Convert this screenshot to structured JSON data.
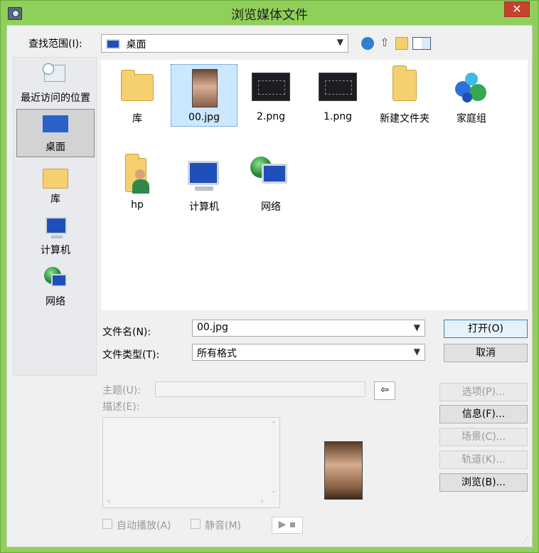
{
  "window": {
    "title": "浏览媒体文件",
    "close_label": "✕"
  },
  "lookin": {
    "label": "查找范围(I):",
    "value": "桌面"
  },
  "places": [
    {
      "label": "最近访问的位置",
      "icon": "recent-places-icon"
    },
    {
      "label": "桌面",
      "icon": "desktop-icon",
      "selected": true
    },
    {
      "label": "库",
      "icon": "library-icon"
    },
    {
      "label": "计算机",
      "icon": "computer-icon"
    },
    {
      "label": "网络",
      "icon": "network-icon"
    }
  ],
  "files": [
    {
      "name": "库",
      "icon": "library-folder-icon"
    },
    {
      "name": "00.jpg",
      "icon": "photo-thumbnail-icon",
      "selected": true
    },
    {
      "name": "2.png",
      "icon": "screenshot-thumbnail-icon"
    },
    {
      "name": "1.png",
      "icon": "screenshot-thumbnail-icon"
    },
    {
      "name": "新建文件夹",
      "icon": "folder-icon"
    },
    {
      "name": "家庭组",
      "icon": "homegroup-icon"
    },
    {
      "name": "hp",
      "icon": "user-folder-icon"
    },
    {
      "name": "计算机",
      "icon": "computer-icon"
    },
    {
      "name": "网络",
      "icon": "network-icon"
    }
  ],
  "filename": {
    "label": "文件名(N):",
    "value": "00.jpg"
  },
  "filetype": {
    "label": "文件类型(T):",
    "value": "所有格式"
  },
  "buttons": {
    "open": "打开(O)",
    "cancel": "取消",
    "options": "选项(P)...",
    "info": "信息(F)...",
    "scene": "场景(C)...",
    "track": "轨道(K)...",
    "browse": "浏览(B)..."
  },
  "subject": {
    "label": "主题(U):"
  },
  "description": {
    "label": "描述(E):"
  },
  "autoplay": {
    "label": "自动播放(A)"
  },
  "mute": {
    "label": "静音(M)"
  },
  "colors": {
    "accent": "#8fd05a",
    "close": "#c7412f",
    "selection": "#cce8ff"
  }
}
